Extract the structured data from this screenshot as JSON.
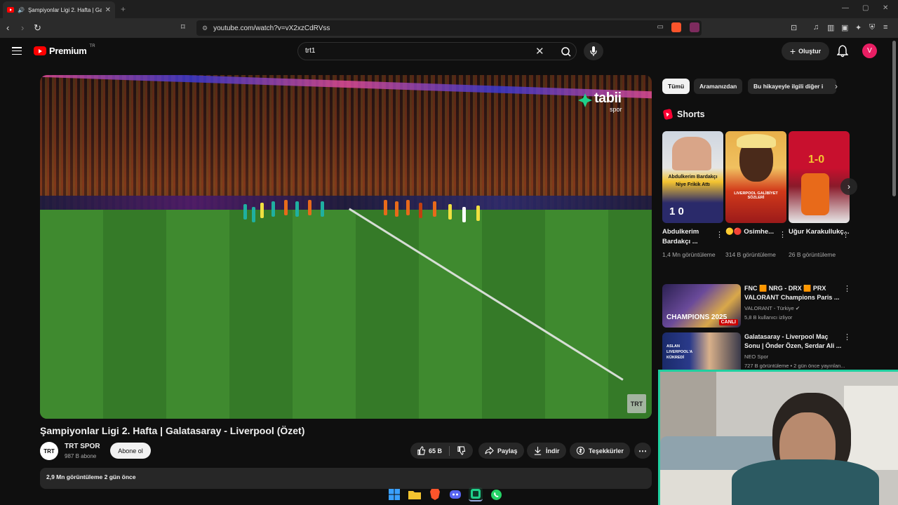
{
  "browser": {
    "tab_title": "Şampiyonlar Ligi 2. Hafta | Ga",
    "tab_close": "✕",
    "new_tab": "+",
    "url": "youtube.com/watch?v=vX2xzCdRVss"
  },
  "header": {
    "logo_text": "Premium",
    "logo_region": "TR",
    "search_query": "trt1",
    "create_label": "Oluştur",
    "avatar_letter": "V"
  },
  "video": {
    "title": "Şampiyonlar Ligi 2. Hafta | Galatasaray - Liverpool (Özet)",
    "watermark_brand": "tabii",
    "watermark_sub": "spor",
    "corner_mark": "TRT",
    "channel_logo": "TRT",
    "channel_name": "TRT SPOR",
    "subscribers": "987 B abone",
    "subscribe_label": "Abone ol",
    "like_count": "65 B",
    "share_label": "Paylaş",
    "download_label": "İndir",
    "thanks_label": "Teşekkürler",
    "stats": "2,9 Mn görüntüleme  2 gün önce"
  },
  "chips": [
    {
      "label": "Tümü",
      "active": true
    },
    {
      "label": "Aramanızdan",
      "active": false
    },
    {
      "label": "Bu hikayeyle ilgili diğer i",
      "active": false
    }
  ],
  "shorts": {
    "heading": "Shorts",
    "items": [
      {
        "title": "Abdulkerim Bardakçı ...",
        "views": "1,4 Mn görüntüleme",
        "overlay": "Abdulkerim Bardakçı Niye Frikik Attı",
        "score": "1 0"
      },
      {
        "title": "🟡🔴 Osimhe...",
        "views": "314 B görüntüleme",
        "overlay": "LIVERPOOL GALİBİYET SÖZLERİ",
        "score": ""
      },
      {
        "title": "Uğur Karakullukç...",
        "views": "26 B görüntüleme",
        "overlay": "",
        "score": "1-0"
      }
    ]
  },
  "recommendations": [
    {
      "title": "FNC 🟧 NRG - DRX 🟧 PRX VALORANT Champions Paris ...",
      "channel": "VALORANT - Türkiye ✔",
      "meta": "5,8 B kullanıcı izliyor",
      "badge": "CANLI",
      "thumb_text": "CHAMPIONS 2025"
    },
    {
      "title": "Galatasaray - Liverpool Maç Sonu | Önder Özen, Serdar Ali ...",
      "channel": "NEO Spor",
      "meta": "727 B görüntüleme • 2 gün önce yayınlan...",
      "badge": "",
      "thumb_text": "ASLAN LIVERPOOL'A KÜKREDİ"
    }
  ],
  "colors": {
    "accent_red": "#ff0000",
    "webcam_border": "#1fd0a0",
    "avatar_bg": "#e91e63"
  }
}
